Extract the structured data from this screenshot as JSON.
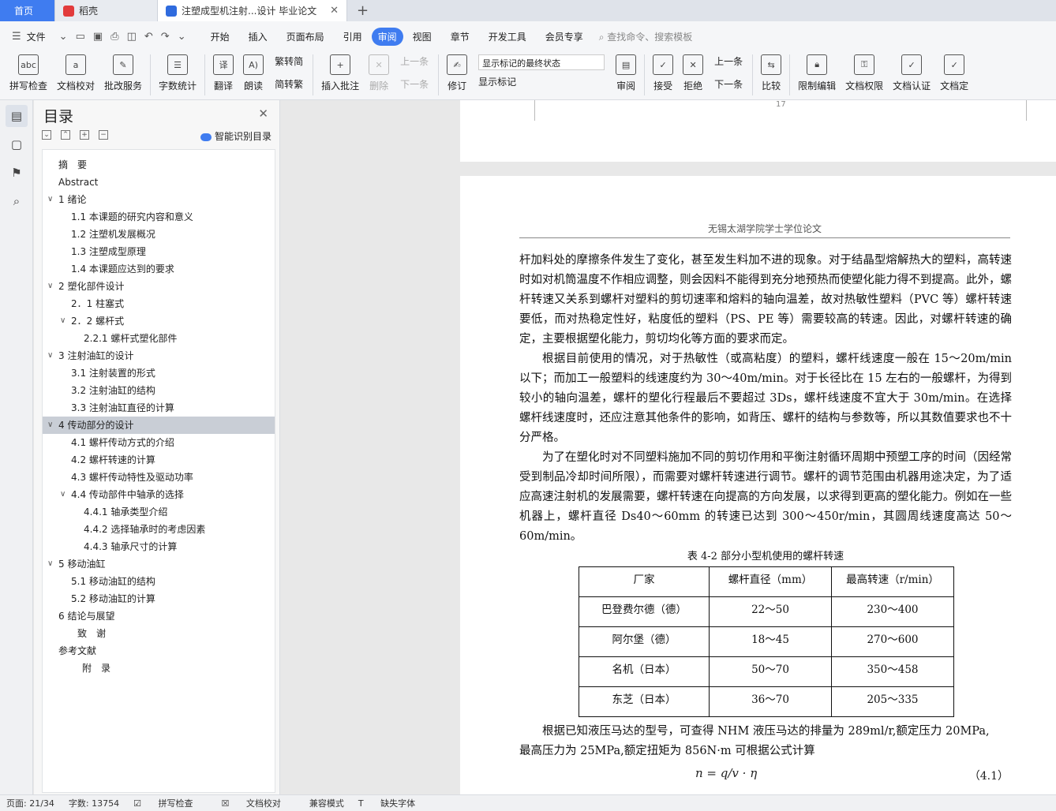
{
  "tabs": {
    "home": "首页",
    "daoke": "稻壳",
    "doc": "注塑成型机注射...设计 毕业论文",
    "new_tab": "+"
  },
  "menu": {
    "file": "文件",
    "items": [
      "开始",
      "插入",
      "页面布局",
      "引用",
      "审阅",
      "视图",
      "章节",
      "开发工具",
      "会员专享"
    ],
    "active": "审阅",
    "search": "查找命令、搜索模板"
  },
  "ribbon": {
    "spellcheck": "拼写检查",
    "doc_proof": "文档校对",
    "batch_service": "批改服务",
    "word_count": "字数统计",
    "translate": "翻译",
    "read_aloud": "朗读",
    "to_traditional": "繁转简",
    "to_simplified": "简转繁",
    "insert_comment": "插入批注",
    "delete": "删除",
    "prev_comment": "上一条",
    "next_comment": "下一条",
    "track_changes": "修订",
    "markup_state": "显示标记的最终状态",
    "show_markup": "显示标记",
    "review": "审阅",
    "accept": "接受",
    "reject": "拒绝",
    "prev_change": "上一条",
    "next_change": "下一条",
    "compare": "比较",
    "restrict_edit": "限制编辑",
    "doc_permission": "文档权限",
    "doc_cert": "文档认证",
    "doc_more": "文档定"
  },
  "toc": {
    "title": "目录",
    "smart": "智能识别目录",
    "items": [
      {
        "text": "摘　要",
        "level": 0,
        "caret": ""
      },
      {
        "text": "Abstract",
        "level": 0,
        "caret": ""
      },
      {
        "text": "1  绪论",
        "level": 0,
        "caret": "v"
      },
      {
        "text": "1.1  本课题的研究内容和意义",
        "level": 1,
        "caret": ""
      },
      {
        "text": "1.2  注塑机发展概况",
        "level": 1,
        "caret": ""
      },
      {
        "text": "1.3 注塑成型原理",
        "level": 1,
        "caret": ""
      },
      {
        "text": "1.4 本课题应达到的要求",
        "level": 1,
        "caret": ""
      },
      {
        "text": "2  塑化部件设计",
        "level": 0,
        "caret": "v"
      },
      {
        "text": "2．1 柱塞式",
        "level": 1,
        "caret": ""
      },
      {
        "text": "2．2  螺杆式",
        "level": 1,
        "caret": "v"
      },
      {
        "text": "2.2.1  螺杆式塑化部件",
        "level": 2,
        "caret": ""
      },
      {
        "text": "3  注射油缸的设计",
        "level": 0,
        "caret": "v"
      },
      {
        "text": "3.1  注射装置的形式",
        "level": 1,
        "caret": ""
      },
      {
        "text": "3.2  注射油缸的结构",
        "level": 1,
        "caret": ""
      },
      {
        "text": "3.3  注射油缸直径的计算",
        "level": 1,
        "caret": ""
      },
      {
        "text": "4  传动部分的设计",
        "level": 0,
        "caret": "v",
        "selected": true
      },
      {
        "text": "4.1  螺杆传动方式的介绍",
        "level": 1,
        "caret": ""
      },
      {
        "text": "4.2  螺杆转速的计算",
        "level": 1,
        "caret": ""
      },
      {
        "text": "4.3  螺杆传动特性及驱动功率",
        "level": 1,
        "caret": ""
      },
      {
        "text": "4.4 传动部件中轴承的选择",
        "level": 1,
        "caret": "v"
      },
      {
        "text": "4.4.1  轴承类型介绍",
        "level": 2,
        "caret": ""
      },
      {
        "text": "4.4.2  选择轴承时的考虑因素",
        "level": 2,
        "caret": ""
      },
      {
        "text": "4.4.3  轴承尺寸的计算",
        "level": 2,
        "caret": ""
      },
      {
        "text": "5  移动油缸",
        "level": 0,
        "caret": "v"
      },
      {
        "text": "5.1  移动油缸的结构",
        "level": 1,
        "caret": ""
      },
      {
        "text": "5.2  移动油缸的计算",
        "level": 1,
        "caret": ""
      },
      {
        "text": "6  结论与展望",
        "level": 0,
        "caret": ""
      },
      {
        "text": "致　谢",
        "level": 3,
        "caret": ""
      },
      {
        "text": "参考文献",
        "level": 0,
        "caret": ""
      },
      {
        "text": "附　录",
        "level": 4,
        "caret": ""
      }
    ]
  },
  "document": {
    "prev_page_num": "17",
    "header": "无锡太湖学院学士学位论文",
    "para1": "杆加料处的摩擦条件发生了变化，甚至发生料加不进的现象。对于结晶型熔解热大的塑料，高转速时如对机筒温度不作相应调整，则会因料不能得到充分地预热而使塑化能力得不到提高。此外，螺杆转速又关系到螺杆对塑料的剪切速率和熔料的轴向温差，故对热敏性塑料（PVC 等）螺杆转速要低，而对热稳定性好，粘度低的塑料（PS、PE 等）需要较高的转速。因此，对螺杆转速的确定，主要根据塑化能力，剪切均化等方面的要求而定。",
    "para2": "根据目前使用的情况，对于热敏性（或高粘度）的塑料，螺杆线速度一般在 15～20m/min 以下；而加工一般塑料的线速度约为 30～40m/min。对于长径比在 15 左右的一般螺杆，为得到较小的轴向温差，螺杆的塑化行程最后不要超过 3Ds，螺杆线速度不宜大于 30m/min。在选择螺杆线速度时，还应注意其他条件的影响，如背压、螺杆的结构与参数等，所以其数值要求也不十分严格。",
    "para3": "为了在塑化时对不同塑料施加不同的剪切作用和平衡注射循环周期中预塑工序的时间（因经常受到制品冷却时间所限），而需要对螺杆转速进行调节。螺杆的调节范围由机器用途决定，为了适应高速注射机的发展需要，螺杆转速在向提高的方向发展，以求得到更高的塑化能力。例如在一些机器上，螺杆直径 Ds40～60mm 的转速已达到 300～450r/min，其圆周线速度高达 50～60m/min。",
    "table_caption": "表 4-2 部分小型机使用的螺杆转速",
    "table_headers": [
      "厂家",
      "螺杆直径（mm）",
      "最高转速（r/min）"
    ],
    "table_rows": [
      [
        "巴登费尔德（德）",
        "22～50",
        "230～400"
      ],
      [
        "阿尔堡（德）",
        "18～45",
        "270～600"
      ],
      [
        "名机（日本）",
        "50～70",
        "350～458"
      ],
      [
        "东芝（日本）",
        "36～70",
        "205～335"
      ]
    ],
    "para4a": "根据已知液压马达的型号，可查得 NHM 液压马达的排量为 289ml/r,额定压力 20MPa,",
    "para4b": "最高压力为 25MPa,额定扭矩为 856N·m 可根据公式计算",
    "formula": "n = q/v · η",
    "eq_num": "（4.1）"
  },
  "status": {
    "page": "页面: 21/34",
    "words": "字数: 13754",
    "spell": "拼写检查",
    "proof": "文档校对",
    "compat": "兼容模式",
    "missing_font": "缺失字体"
  }
}
